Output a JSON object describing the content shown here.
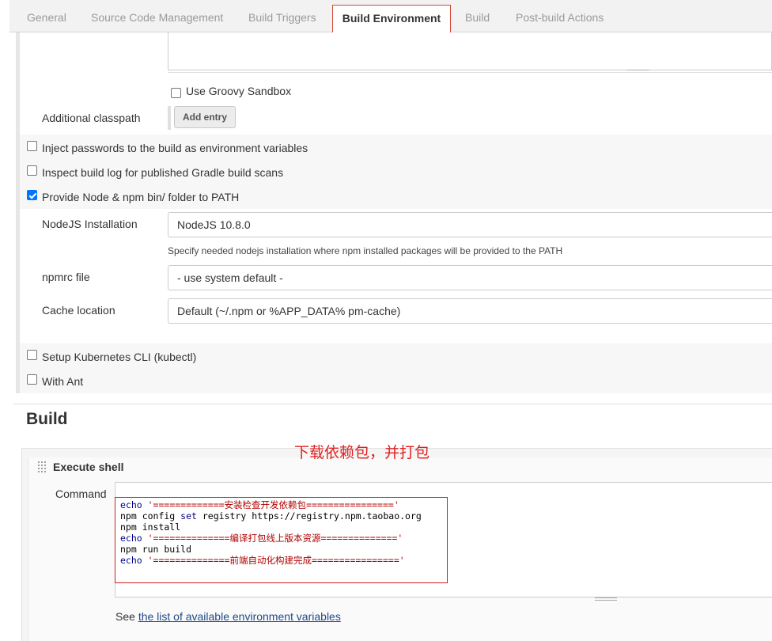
{
  "tabs": {
    "general": "General",
    "scm": "Source Code Management",
    "triggers": "Build Triggers",
    "env": "Build Environment",
    "build": "Build",
    "post": "Post-build Actions"
  },
  "groovy": {
    "sandbox_label": "Use Groovy Sandbox",
    "classpath_label": "Additional classpath",
    "add_entry": "Add entry"
  },
  "options": {
    "inject_passwords": "Inject passwords to the build as environment variables",
    "inspect_gradle": "Inspect build log for published Gradle build scans",
    "provide_node": "Provide Node & npm bin/ folder to PATH",
    "setup_k8s": "Setup Kubernetes CLI (kubectl)",
    "with_ant": "With Ant"
  },
  "node": {
    "installation_label": "NodeJS Installation",
    "installation_value": "NodeJS 10.8.0",
    "installation_help": "Specify needed nodejs installation where npm installed packages will be provided to the PATH",
    "npmrc_label": "npmrc file",
    "npmrc_value": "- use system default -",
    "cache_label": "Cache location",
    "cache_value": "Default (~/.npm or %APP_DATA% pm-cache)"
  },
  "build": {
    "heading": "Build",
    "annotation": "下载依赖包，并打包",
    "step_title": "Execute shell",
    "command_label": "Command",
    "lines": {
      "l1_cmd": "echo ",
      "l1_str": "'=============安装检查开发依赖包================'",
      "l2_cmd": "npm config ",
      "l2_kw": "set",
      "l2_rest": " registry https://registry.npm.taobao.org",
      "l3": "npm install",
      "l4_cmd": "echo ",
      "l4_str": "'==============编译打包线上版本资源=============='",
      "l5": "npm run build",
      "l6_cmd": "echo ",
      "l6_str": "'==============前端自动化构建完成================'"
    },
    "see_prefix": "See ",
    "see_link": "the list of available environment variables"
  },
  "colors": {
    "accent_red": "#d24939",
    "checkbox_blue": "#0075ff",
    "link": "#204a87"
  }
}
